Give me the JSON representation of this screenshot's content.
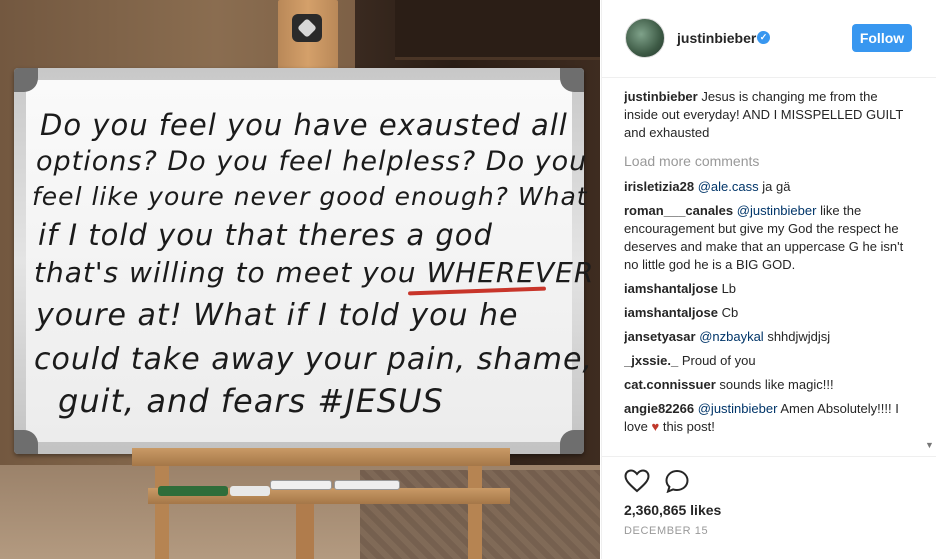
{
  "photo": {
    "board_lines": [
      "Do you feel you have exausted all",
      "options? Do you feel helpless? Do you",
      "feel like youre never good enough? What",
      "if I told you that theres a god",
      "that's willing to meet you WHEREVER",
      "youre at! What if I told you he",
      "could take away your pain, shame,",
      "guit, and fears #JESUS"
    ]
  },
  "post": {
    "username": "justinbieber",
    "verified_mark": "✓",
    "follow_label": "Follow",
    "caption_user": "justinbieber",
    "caption_text": "Jesus is changing me from the inside out everyday! AND I MISSPELLED GUILT and exhausted",
    "load_more": "Load more comments",
    "comments": [
      {
        "user": "irisletizia28",
        "mention": "@ale.cass",
        "text": "ja gä"
      },
      {
        "user": "roman___canales",
        "mention": "@justinbieber",
        "text": "like the encouragement but give my God the respect he deserves and make that an uppercase G he isn't no little god he is a BIG GOD."
      },
      {
        "user": "iamshantaljose",
        "mention": "",
        "text": "Lb"
      },
      {
        "user": "iamshantaljose",
        "mention": "",
        "text": "Cb"
      },
      {
        "user": "jansetyasar",
        "mention": "@nzbaykal",
        "text": "shhdjwjdjsj"
      },
      {
        "user": "_jxssie._",
        "mention": "",
        "text": "Proud of you"
      },
      {
        "user": "cat.connissuer",
        "mention": "",
        "text": "sounds like magic!!!"
      },
      {
        "user": "angie82266",
        "mention": "@justinbieber",
        "text": "Amen Absolutely!!!! I love",
        "heart": "♥",
        "text_after": "this post!"
      }
    ],
    "likes": "2,360,865 likes",
    "date": "DECEMBER 15",
    "scroll_arrow": "▼"
  }
}
